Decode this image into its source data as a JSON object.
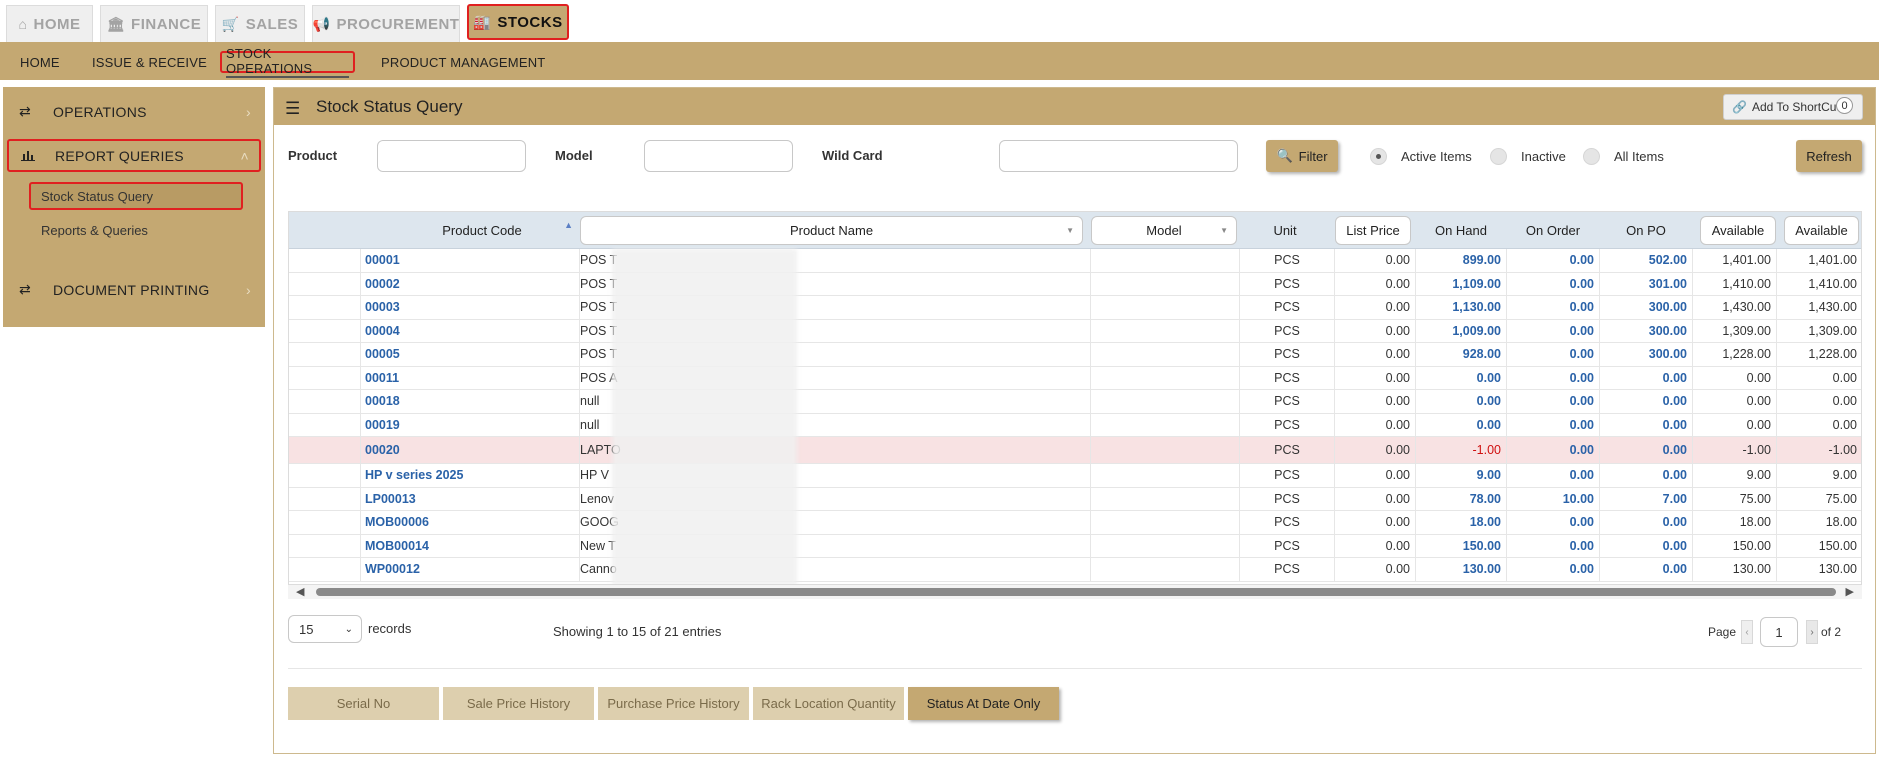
{
  "top_tabs": [
    {
      "label": "HOME",
      "icon": "home-icon",
      "glyph": "⌂"
    },
    {
      "label": "FINANCE",
      "icon": "bank-icon",
      "glyph": "🏛"
    },
    {
      "label": "SALES",
      "icon": "cart-icon",
      "glyph": "🛒"
    },
    {
      "label": "PROCUREMENT",
      "icon": "bullhorn-icon",
      "glyph": "📢"
    },
    {
      "label": "STOCKS",
      "icon": "factory-icon",
      "glyph": "🏭"
    }
  ],
  "sub_nav": [
    "HOME",
    "ISSUE & RECEIVE",
    "STOCK OPERATIONS",
    "PRODUCT MANAGEMENT"
  ],
  "sidebar": {
    "operations": "OPERATIONS",
    "report_queries": "REPORT QUERIES",
    "stock_status_query": "Stock Status Query",
    "reports_queries": "Reports & Queries",
    "document_printing": "DOCUMENT PRINTING"
  },
  "panel": {
    "title": "Stock Status Query",
    "shortcut_label": "Add To ShortCut",
    "shortcut_count": "0"
  },
  "filters": {
    "product_label": "Product",
    "model_label": "Model",
    "wildcard_label": "Wild Card",
    "filter_button": "Filter",
    "radio_active": "Active Items",
    "radio_inactive": "Inactive",
    "radio_all": "All Items",
    "refresh_button": "Refresh"
  },
  "grid": {
    "columns": [
      "Product Code",
      "Product Name",
      "Model",
      "Unit",
      "List Price",
      "On Hand",
      "On Order",
      "On PO",
      "Available",
      "Available"
    ],
    "rows": [
      {
        "code": "00001",
        "name": "POS T",
        "unit": "PCS",
        "list": "0.00",
        "hand": "899.00",
        "order": "0.00",
        "po": "502.00",
        "avail1": "1,401.00",
        "avail2": "1,401.00"
      },
      {
        "code": "00002",
        "name": "POS T",
        "unit": "PCS",
        "list": "0.00",
        "hand": "1,109.00",
        "order": "0.00",
        "po": "301.00",
        "avail1": "1,410.00",
        "avail2": "1,410.00"
      },
      {
        "code": "00003",
        "name": "POS T",
        "unit": "PCS",
        "list": "0.00",
        "hand": "1,130.00",
        "order": "0.00",
        "po": "300.00",
        "avail1": "1,430.00",
        "avail2": "1,430.00"
      },
      {
        "code": "00004",
        "name": "POS T",
        "unit": "PCS",
        "list": "0.00",
        "hand": "1,009.00",
        "order": "0.00",
        "po": "300.00",
        "avail1": "1,309.00",
        "avail2": "1,309.00"
      },
      {
        "code": "00005",
        "name": "POS T",
        "unit": "PCS",
        "list": "0.00",
        "hand": "928.00",
        "order": "0.00",
        "po": "300.00",
        "avail1": "1,228.00",
        "avail2": "1,228.00"
      },
      {
        "code": "00011",
        "name": "POS A",
        "unit": "PCS",
        "list": "0.00",
        "hand": "0.00",
        "order": "0.00",
        "po": "0.00",
        "avail1": "0.00",
        "avail2": "0.00"
      },
      {
        "code": "00018",
        "name": "null",
        "unit": "PCS",
        "list": "0.00",
        "hand": "0.00",
        "order": "0.00",
        "po": "0.00",
        "avail1": "0.00",
        "avail2": "0.00"
      },
      {
        "code": "00019",
        "name": "null",
        "unit": "PCS",
        "list": "0.00",
        "hand": "0.00",
        "order": "0.00",
        "po": "0.00",
        "avail1": "0.00",
        "avail2": "0.00"
      },
      {
        "code": "00020",
        "name": "LAPTO",
        "unit": "PCS",
        "list": "0.00",
        "hand": "-1.00",
        "order": "0.00",
        "po": "0.00",
        "avail1": "-1.00",
        "avail2": "-1.00"
      },
      {
        "code": "HP v series 2025",
        "name": "HP V",
        "unit": "PCS",
        "list": "0.00",
        "hand": "9.00",
        "order": "0.00",
        "po": "0.00",
        "avail1": "9.00",
        "avail2": "9.00"
      },
      {
        "code": "LP00013",
        "name": "Lenov",
        "unit": "PCS",
        "list": "0.00",
        "hand": "78.00",
        "order": "10.00",
        "po": "7.00",
        "avail1": "75.00",
        "avail2": "75.00"
      },
      {
        "code": "MOB00006",
        "name": "GOOG",
        "unit": "PCS",
        "list": "0.00",
        "hand": "18.00",
        "order": "0.00",
        "po": "0.00",
        "avail1": "18.00",
        "avail2": "18.00"
      },
      {
        "code": "MOB00014",
        "name": "New T",
        "unit": "PCS",
        "list": "0.00",
        "hand": "150.00",
        "order": "0.00",
        "po": "0.00",
        "avail1": "150.00",
        "avail2": "150.00"
      },
      {
        "code": "WP00012",
        "name": "Canno",
        "unit": "PCS",
        "list": "0.00",
        "hand": "130.00",
        "order": "0.00",
        "po": "0.00",
        "avail1": "130.00",
        "avail2": "130.00"
      }
    ]
  },
  "pagination": {
    "page_size": "15",
    "records_label": "records",
    "showing": "Showing 1 to 15 of 21 entries",
    "page_label": "Page",
    "page_value": "1",
    "of_label": "of 2"
  },
  "bottom_tabs": [
    "Serial No",
    "Sale Price History",
    "Purchase Price History",
    "Rack Location Quantity",
    "Status At Date Only"
  ],
  "colors": {
    "accent": "#c4a872",
    "highlight": "#e02020",
    "link": "#2a62a8",
    "negative": "#d01010"
  }
}
